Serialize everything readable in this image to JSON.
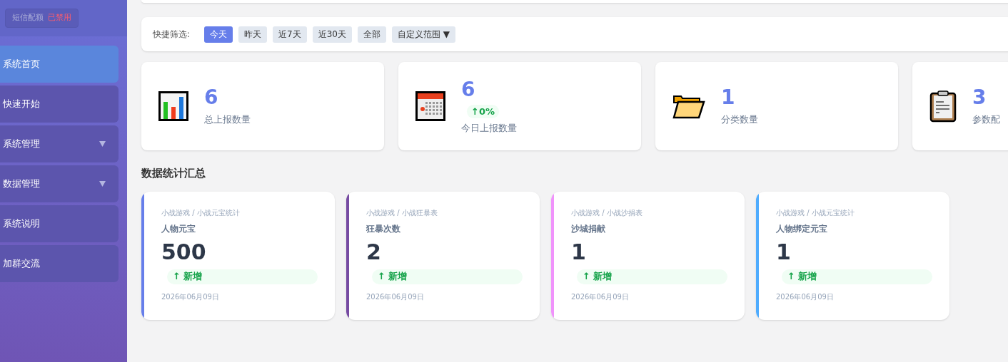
{
  "sidebar": {
    "sms_quota": {
      "label": "短信配额",
      "status": "已禁用"
    },
    "items": [
      {
        "label": "系统首页",
        "selected": true,
        "has_submenu": false
      },
      {
        "label": "快速开始",
        "selected": false,
        "has_submenu": false
      },
      {
        "label": "系统管理",
        "selected": false,
        "has_submenu": true
      },
      {
        "label": "数据管理",
        "selected": false,
        "has_submenu": true
      },
      {
        "label": "系统说明",
        "selected": false,
        "has_submenu": false
      },
      {
        "label": "加群交流",
        "selected": false,
        "has_submenu": false
      }
    ]
  },
  "quick_filter": {
    "label": "快捷筛选:",
    "options": [
      {
        "label": "今天",
        "selected": true
      },
      {
        "label": "昨天",
        "selected": false
      },
      {
        "label": "近7天",
        "selected": false
      },
      {
        "label": "近30天",
        "selected": false
      },
      {
        "label": "全部",
        "selected": false
      },
      {
        "label": "自定义范围 ▼",
        "selected": false
      }
    ]
  },
  "stats": [
    {
      "kind": "chart",
      "value": "6",
      "label": "总上报数量"
    },
    {
      "kind": "calendar",
      "value": "6",
      "change": "↑0%",
      "label": "今日上报数量"
    },
    {
      "kind": "folder",
      "value": "1",
      "label": "分类数量"
    },
    {
      "kind": "clipboard",
      "value": "3",
      "label": "参数配"
    }
  ],
  "summary": {
    "title": "数据统计汇总",
    "cards": [
      {
        "path": "小战游戏 / 小战元宝统计",
        "name": "人物元宝",
        "value": "500",
        "badge": "↑ 新增",
        "date": "2026年06月09日",
        "color": "#667eea"
      },
      {
        "path": "小战游戏 / 小战狂暴表",
        "name": "狂暴次数",
        "value": "2",
        "badge": "↑ 新增",
        "date": "2026年06月09日",
        "color": "#764ba2"
      },
      {
        "path": "小战游戏 / 小战沙捐表",
        "name": "沙城捐献",
        "value": "1",
        "badge": "↑ 新增",
        "date": "2026年06月09日",
        "color": "#f093fb"
      },
      {
        "path": "小战游戏 / 小战元宝统计",
        "name": "人物绑定元宝",
        "value": "1",
        "badge": "↑ 新增",
        "date": "2026年06月09日",
        "color": "#4facfe"
      }
    ]
  }
}
